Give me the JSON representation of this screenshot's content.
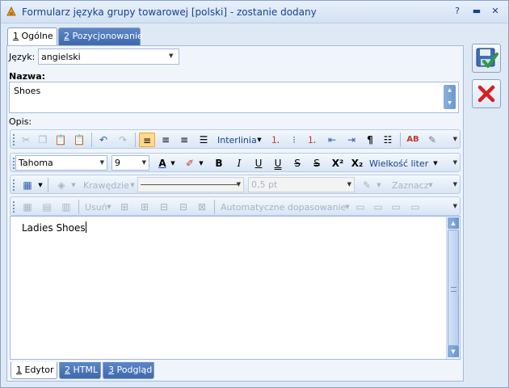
{
  "window": {
    "title": "Formularz języka grupy towarowej [polski] - zostanie dodany",
    "controls": [
      "?",
      "▬",
      "▭",
      "✕"
    ]
  },
  "tabs": [
    {
      "key": "1",
      "label": " Ogólne"
    },
    {
      "key": "2",
      "label": " Pozycjonowanie"
    }
  ],
  "form": {
    "language_label": "Język:",
    "language_value": "angielski",
    "name_label": "Nazwa:",
    "name_value": "Shoes",
    "description_label": "Opis:"
  },
  "toolbar1": {
    "line_spacing": "Interlinia"
  },
  "toolbar2": {
    "font": "Tahoma",
    "size": "9",
    "bold": "B",
    "italic": "I",
    "underline": "U",
    "double_underline": "U",
    "strike": "S",
    "double_strike": "S",
    "superscript": "X²",
    "subscript": "X₂",
    "case": "Wielkość liter"
  },
  "toolbar3": {
    "borders": "Krawędzie",
    "width": "0,5 pt",
    "select": "Zaznacz"
  },
  "toolbar4": {
    "delete": "Usuń",
    "autofit": "Automatyczne dopasowanie"
  },
  "editor": {
    "content": "Ladies Shoes"
  },
  "bottom_tabs": [
    {
      "key": "1",
      "label": " Edytor"
    },
    {
      "key": "2",
      "label": " HTML"
    },
    {
      "key": "3",
      "label": " Podgląd"
    }
  ],
  "colors": {
    "title_text": "#15428b",
    "tab_active": "#ffffff",
    "tab_inactive": "#4a74b8",
    "save_check": "#3aa34a",
    "cancel_x": "#d62020"
  }
}
